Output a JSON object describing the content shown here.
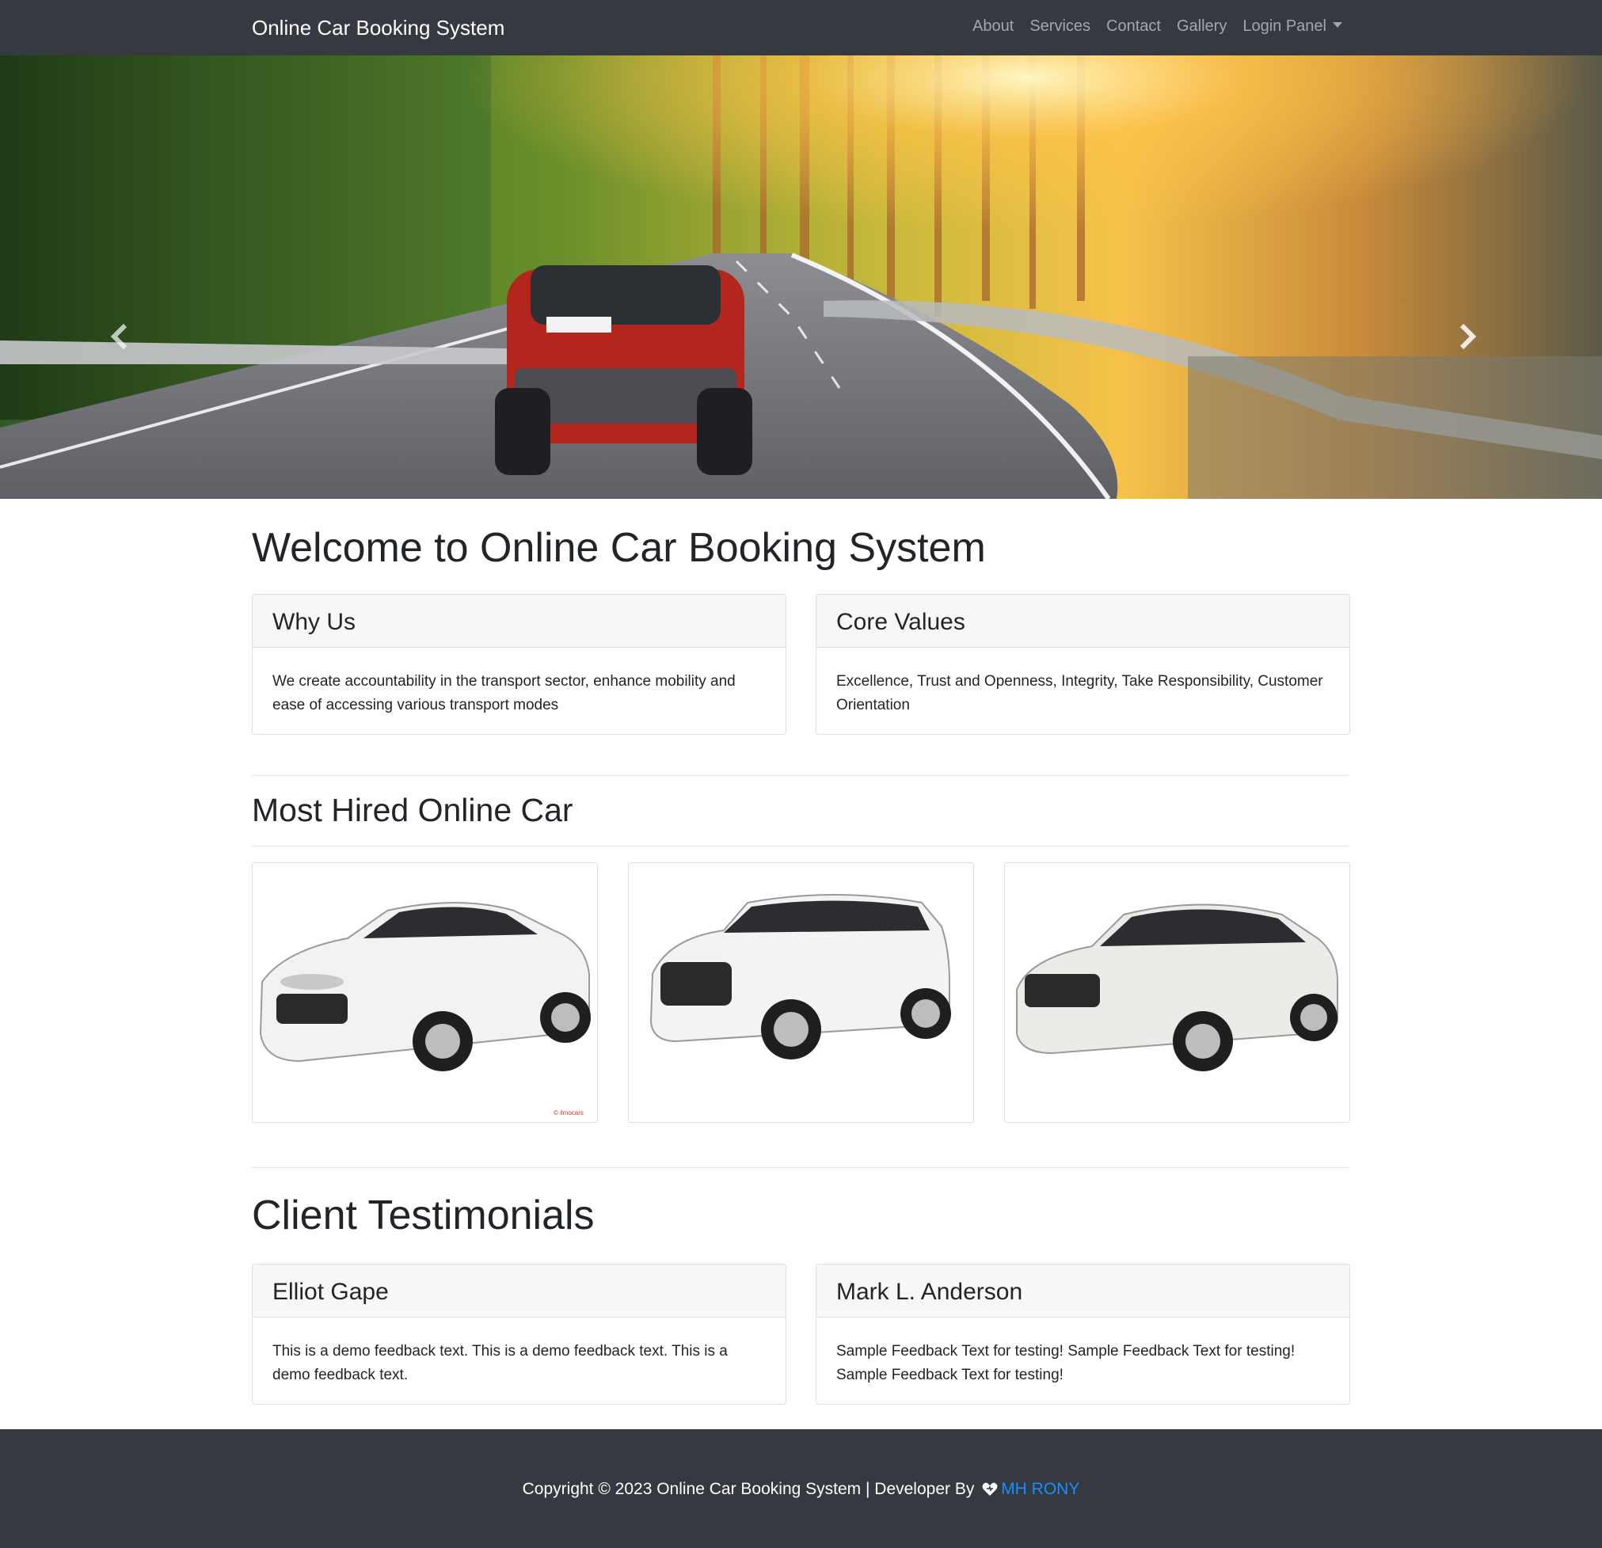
{
  "navbar": {
    "brand": "Online Car Booking System",
    "links": [
      "About",
      "Services",
      "Contact",
      "Gallery"
    ],
    "dropdown_label": "Login Panel"
  },
  "hero": {
    "prev_icon": "chevron-left-icon",
    "next_icon": "chevron-right-icon"
  },
  "main": {
    "welcome_heading": "Welcome to Online Car Booking System",
    "why_us": {
      "title": "Why Us",
      "text": "We create accountability in the transport sector, enhance mobility and ease of accessing various transport modes"
    },
    "core_values": {
      "title": "Core Values",
      "text": "Excellence, Trust and Openness, Integrity, Take Responsibility, Customer Orientation"
    },
    "most_hired_heading": "Most Hired Online Car",
    "car_watermark": "© ilmocars",
    "testimonials_heading": "Client Testimonials",
    "testimonials": [
      {
        "name": "Elliot Gape",
        "text": "This is a demo feedback text. This is a demo feedback text. This is a demo feedback text."
      },
      {
        "name": "Mark L. Anderson",
        "text": "Sample Feedback Text for testing! Sample Feedback Text for testing! Sample Feedback Text for testing!"
      }
    ]
  },
  "footer": {
    "copyright": "Copyright © 2023 Online Car Booking System | Developer By",
    "heart_icon": "heart-icon",
    "developer_link": "MH RONY",
    "link_color": "#1a8cff"
  },
  "colors": {
    "navbar_bg": "#343a40",
    "card_header_bg": "#f7f7f7"
  }
}
